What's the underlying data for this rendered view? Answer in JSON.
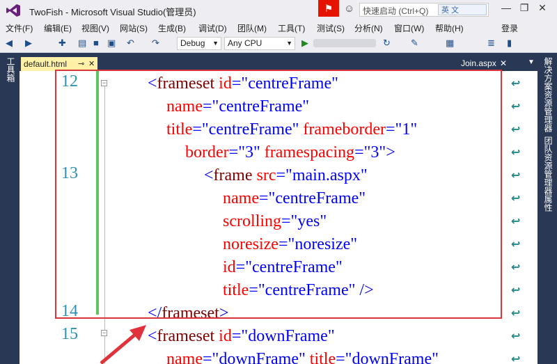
{
  "window": {
    "title": "TwoFish - Microsoft Visual Studio(管理员)",
    "quick_launch_placeholder": "快速启动 (Ctrl+Q)",
    "ime_label": "英 文"
  },
  "menu": [
    {
      "label": "文件(F)"
    },
    {
      "label": "编辑(E)"
    },
    {
      "label": "视图(V)"
    },
    {
      "label": "网站(S)"
    },
    {
      "label": "生成(B)"
    },
    {
      "label": "调试(D)"
    },
    {
      "label": "团队(M)"
    },
    {
      "label": "工具(T)"
    },
    {
      "label": "测试(S)"
    },
    {
      "label": "分析(N)"
    },
    {
      "label": "窗口(W)"
    },
    {
      "label": "帮助(H)"
    }
  ],
  "login_label": "登录",
  "toolbar": {
    "config": "Debug",
    "platform": "Any CPU"
  },
  "left_panel": {
    "toolbox": "工具箱"
  },
  "right_panel": {
    "solution_explorer": "解决方案资源管理器",
    "team_explorer": "团队资源管理器",
    "properties": "属性"
  },
  "tabs": {
    "active": "default.html",
    "inactive": "Join.aspx"
  },
  "editor": {
    "line_numbers": [
      "12",
      "13",
      "14",
      "15"
    ],
    "lines": [
      {
        "lnum": "12",
        "indent": 0,
        "parts": [
          [
            "bracket",
            "<"
          ],
          [
            "tag",
            "frameset"
          ],
          [
            "plain",
            " "
          ],
          [
            "attr",
            "id"
          ],
          [
            "eq",
            "="
          ],
          [
            "str",
            "\"centreFrame\""
          ]
        ]
      },
      {
        "lnum": "",
        "indent": 1,
        "parts": [
          [
            "attr",
            "name"
          ],
          [
            "eq",
            "="
          ],
          [
            "str",
            "\"centreFrame\""
          ]
        ]
      },
      {
        "lnum": "",
        "indent": 1,
        "parts": [
          [
            "attr",
            "title"
          ],
          [
            "eq",
            "="
          ],
          [
            "str",
            "\"centreFrame\""
          ],
          [
            "plain",
            " "
          ],
          [
            "attr",
            "frameborder"
          ],
          [
            "eq",
            "="
          ],
          [
            "str",
            "\"1\""
          ]
        ]
      },
      {
        "lnum": "",
        "indent": 2,
        "parts": [
          [
            "attr",
            "border"
          ],
          [
            "eq",
            "="
          ],
          [
            "str",
            "\"3\""
          ],
          [
            "plain",
            " "
          ],
          [
            "attr",
            "framespacing"
          ],
          [
            "eq",
            "="
          ],
          [
            "str",
            "\"3\""
          ],
          [
            "bracket",
            ">"
          ]
        ]
      },
      {
        "lnum": "13",
        "indent": 3,
        "parts": [
          [
            "bracket",
            "<"
          ],
          [
            "tag",
            "frame"
          ],
          [
            "plain",
            " "
          ],
          [
            "attr",
            "src"
          ],
          [
            "eq",
            "="
          ],
          [
            "str",
            "\"main.aspx\""
          ]
        ]
      },
      {
        "lnum": "",
        "indent": 4,
        "parts": [
          [
            "attr",
            "name"
          ],
          [
            "eq",
            "="
          ],
          [
            "str",
            "\"centreFrame\""
          ]
        ]
      },
      {
        "lnum": "",
        "indent": 4,
        "parts": [
          [
            "attr",
            "scrolling"
          ],
          [
            "eq",
            "="
          ],
          [
            "str",
            "\"yes\""
          ]
        ]
      },
      {
        "lnum": "",
        "indent": 4,
        "parts": [
          [
            "attr",
            "noresize"
          ],
          [
            "eq",
            "="
          ],
          [
            "str",
            "\"noresize\""
          ]
        ]
      },
      {
        "lnum": "",
        "indent": 4,
        "parts": [
          [
            "attr",
            "id"
          ],
          [
            "eq",
            "="
          ],
          [
            "str",
            "\"centreFrame\""
          ]
        ]
      },
      {
        "lnum": "",
        "indent": 4,
        "parts": [
          [
            "attr",
            "title"
          ],
          [
            "eq",
            "="
          ],
          [
            "str",
            "\"centreFrame\""
          ],
          [
            "plain",
            " "
          ],
          [
            "bracket",
            "/>"
          ]
        ]
      },
      {
        "lnum": "14",
        "indent": 0,
        "parts": [
          [
            "bracket",
            "</"
          ],
          [
            "tag",
            "frameset"
          ],
          [
            "bracket",
            ">"
          ]
        ]
      },
      {
        "lnum": "15",
        "indent": 0,
        "parts": [
          [
            "bracket",
            "<"
          ],
          [
            "tag",
            "frameset"
          ],
          [
            "plain",
            " "
          ],
          [
            "attr",
            "id"
          ],
          [
            "eq",
            "="
          ],
          [
            "str",
            "\"downFrame\""
          ]
        ]
      },
      {
        "lnum": "",
        "indent": 1,
        "parts": [
          [
            "attr",
            "name"
          ],
          [
            "eq",
            "="
          ],
          [
            "str",
            "\"downFrame\""
          ],
          [
            "plain",
            " "
          ],
          [
            "attr",
            "title"
          ],
          [
            "eq",
            "="
          ],
          [
            "str",
            "\"downFrame\""
          ]
        ]
      }
    ]
  },
  "colors": {
    "highlight_box": "#d9353b",
    "change_bar": "#5ec45e",
    "line_number": "#2b91af"
  }
}
